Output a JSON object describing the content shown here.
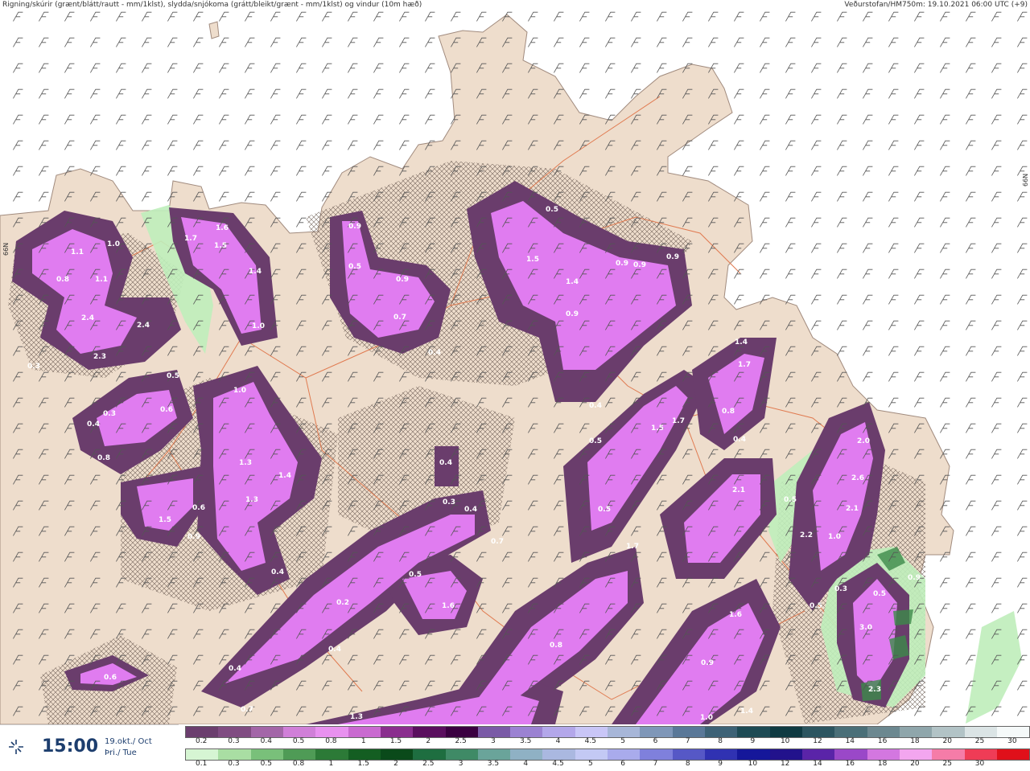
{
  "header": {
    "left": "Rigning/skúrir (grænt/blátt/rautt - mm/1klst), slydda/snjókoma (grátt/bleikt/grænt - mm/1klst) og vindur (10m hæð)",
    "right": "Veðurstofan/HM750m: 19.10.2021 06:00 UTC (+9)"
  },
  "side_tags": {
    "left": "66N",
    "right": "66N"
  },
  "time": {
    "clock": "15:00",
    "date_line1": "19.okt./ Oct",
    "date_line2": "Þri./ Tue"
  },
  "icons": {
    "wind_symbol": "wind-barb-icon",
    "time_icon": "weather-spark-icon"
  },
  "legend": {
    "snow_ticks": [
      "0.2",
      "0.3",
      "0.4",
      "0.5",
      "0.8",
      "1",
      "1.5",
      "2",
      "2.5",
      "3",
      "3.5",
      "4",
      "4.5",
      "5",
      "6",
      "7",
      "8",
      "9",
      "10",
      "12",
      "14",
      "16",
      "18",
      "20",
      "25",
      "30"
    ],
    "rain_ticks": [
      "0.1",
      "0.3",
      "0.5",
      "0.8",
      "1",
      "1.5",
      "2",
      "2.5",
      "3",
      "3.5",
      "4",
      "4.5",
      "5",
      "6",
      "7",
      "8",
      "9",
      "10",
      "12",
      "14",
      "16",
      "18",
      "20",
      "25",
      "30"
    ],
    "snow_colors": [
      "#6b3e6e",
      "#804c82",
      "#a366a8",
      "#d07fd8",
      "#e891ef",
      "#c96ad0",
      "#8a2e8e",
      "#5a0f5e",
      "#3a0040",
      "#7a5aa6",
      "#9b82d2",
      "#b3a7ea",
      "#c9c6f7",
      "#a7b6d8",
      "#7f97b8",
      "#5a7898",
      "#3d6276",
      "#1d4a54",
      "#0f3a42",
      "#2c5560",
      "#4a6f78",
      "#6c8890",
      "#8fa6ab",
      "#b2c3c6",
      "#dbe4e5",
      "#f5f9f9"
    ],
    "rain_colors": [
      "#d6f5d3",
      "#a9dea3",
      "#79c07a",
      "#4f9b56",
      "#2c7a37",
      "#145e22",
      "#0a4a1a",
      "#1e6e40",
      "#3f8a66",
      "#6aa49a",
      "#8fb1c4",
      "#aab8e0",
      "#c3c9f4",
      "#a9abec",
      "#7f80dc",
      "#5658c6",
      "#3032b2",
      "#15179a",
      "#22128c",
      "#5a24a8",
      "#9a48c8",
      "#d377e0",
      "#f3a6ef",
      "#f57ca8",
      "#ef3c56",
      "#e0101a"
    ]
  },
  "map": {
    "colors": {
      "sea": "#ffffff",
      "land": "#eeddcc",
      "road": "#e07a50",
      "snow_light": "#e07cf0",
      "snow_dark": "#6a3d6c",
      "rain_light": "#bfeebb"
    },
    "precip_labels": [
      "1.0",
      "1.1",
      "0.8",
      "1.1",
      "2.4",
      "2.4",
      "2.3",
      "0.3",
      "1.7",
      "1.6",
      "1.5",
      "1.4",
      "1.0",
      "0.9",
      "0.5",
      "0.9",
      "0.7",
      "0.4",
      "0.5",
      "1.5",
      "1.4",
      "0.9",
      "0.9",
      "0.9",
      "0.9",
      "0.4",
      "0.5",
      "1.5",
      "1.7",
      "0.8",
      "0.4",
      "1.4",
      "1.7",
      "1.0",
      "1.3",
      "1.4",
      "1.3",
      "0.6",
      "0.5",
      "0.4",
      "0.3",
      "0.8",
      "0.9",
      "0.6",
      "1.5",
      "0.4",
      "0.3",
      "0.4",
      "0.7",
      "0.5",
      "1.6",
      "0.4",
      "0.2",
      "0.4",
      "0.5",
      "2.1",
      "0.5",
      "1.7",
      "2.0",
      "2.6",
      "2.1",
      "0.5",
      "1.0",
      "2.2",
      "0.9",
      "0.3",
      "0.5",
      "3.0",
      "2.3",
      "1.6",
      "0.8",
      "0.9",
      "1.0",
      "1.4",
      "1.3",
      "0.7",
      "0.4",
      "0.6"
    ]
  }
}
